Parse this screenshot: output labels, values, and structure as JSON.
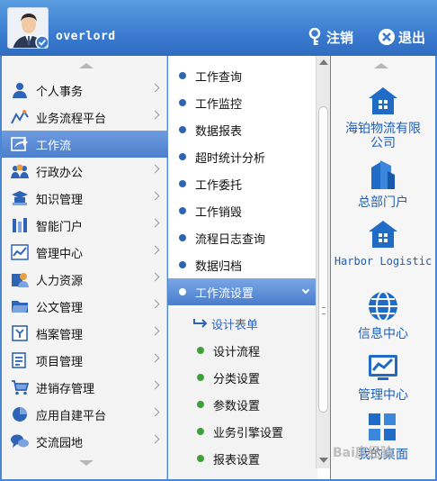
{
  "header": {
    "username": "overlord",
    "logout_label": "注销",
    "exit_label": "退出"
  },
  "left_nav": [
    {
      "label": "个人事务",
      "icon": "person-icon"
    },
    {
      "label": "业务流程平台",
      "icon": "flow-icon"
    },
    {
      "label": "工作流",
      "icon": "workflow-arrow-icon",
      "active": true
    },
    {
      "label": "行政办公",
      "icon": "group-icon"
    },
    {
      "label": "知识管理",
      "icon": "knowledge-icon"
    },
    {
      "label": "智能门户",
      "icon": "portal-icon"
    },
    {
      "label": "管理中心",
      "icon": "chart-icon"
    },
    {
      "label": "人力资源",
      "icon": "hr-icon"
    },
    {
      "label": "公文管理",
      "icon": "folder-icon"
    },
    {
      "label": "档案管理",
      "icon": "archive-icon"
    },
    {
      "label": "项目管理",
      "icon": "project-icon"
    },
    {
      "label": "进销存管理",
      "icon": "cart-icon"
    },
    {
      "label": "应用自建平台",
      "icon": "pie-icon"
    },
    {
      "label": "交流园地",
      "icon": "chat-icon"
    }
  ],
  "sub_nav": [
    {
      "label": "工作查询"
    },
    {
      "label": "工作监控"
    },
    {
      "label": "数据报表"
    },
    {
      "label": "超时统计分析"
    },
    {
      "label": "工作委托"
    },
    {
      "label": "工作销毁"
    },
    {
      "label": "流程日志查询"
    },
    {
      "label": "数据归档"
    },
    {
      "label": "工作流设置",
      "active": true
    }
  ],
  "third_nav": [
    {
      "label": "设计表单",
      "current": true
    },
    {
      "label": "设计流程"
    },
    {
      "label": "分类设置"
    },
    {
      "label": "参数设置"
    },
    {
      "label": "业务引擎设置"
    },
    {
      "label": "报表设置"
    }
  ],
  "right_tiles": [
    {
      "label": "海铂物流有限公司",
      "icon": "home-icon"
    },
    {
      "label": "总部门户",
      "icon": "building-icon"
    },
    {
      "label": "Harbor Logistic",
      "icon": "home-icon",
      "mono": true
    },
    {
      "label": "信息中心",
      "icon": "globe-icon"
    },
    {
      "label": "管理中心",
      "icon": "monitor-chart-icon"
    },
    {
      "label": "我的桌面",
      "icon": "desktop-icon"
    }
  ],
  "watermark": "Bai度经验",
  "colors": {
    "header_blue": "#3b7cd0",
    "active_blue": "#4c7fcb",
    "link_blue": "#1f5fb8",
    "dot_green": "#3fa03a"
  }
}
